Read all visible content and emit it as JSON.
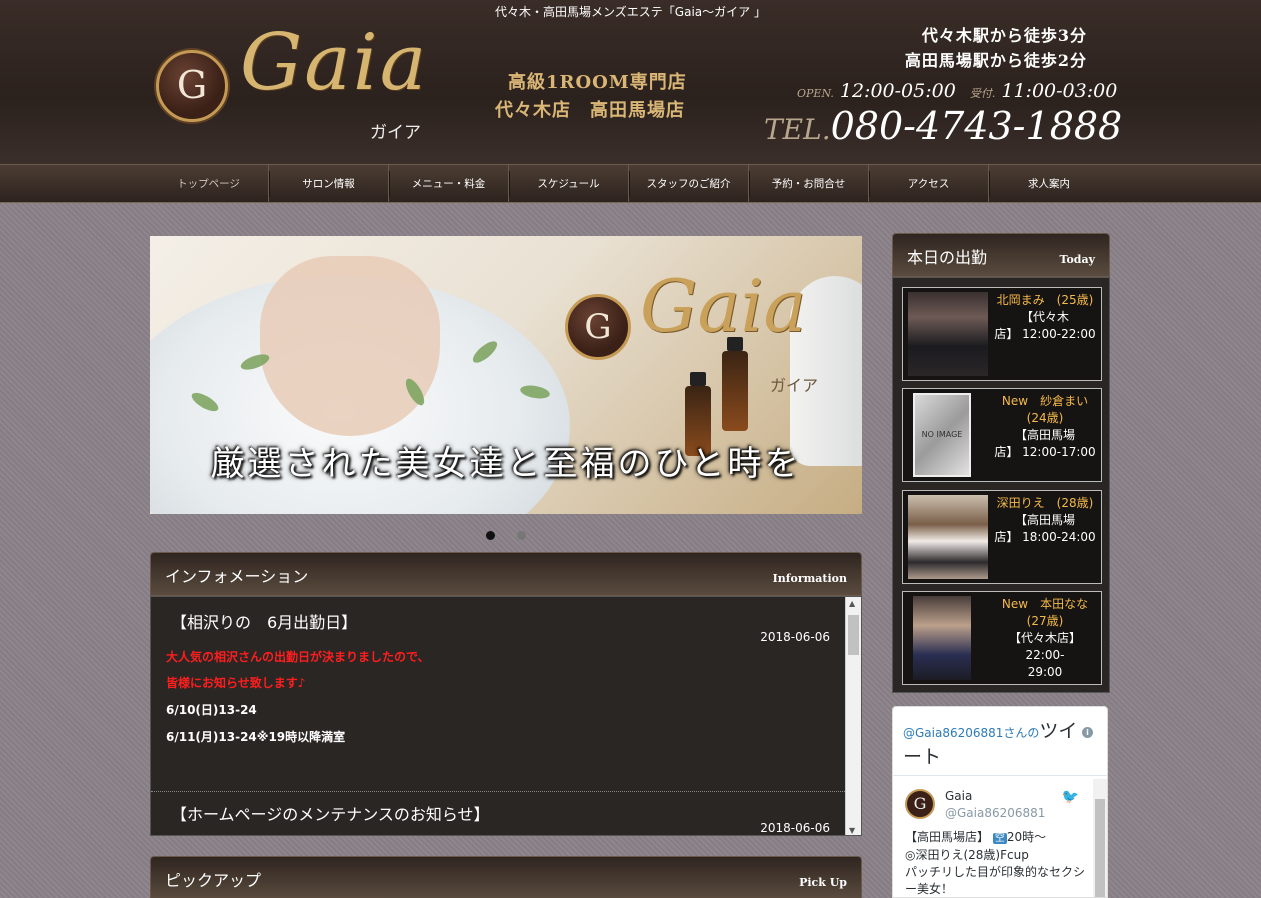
{
  "header": {
    "tagline": "代々木・高田馬場メンズエステ「Gaia～ガイア 」",
    "logo_letter": "G",
    "logo_script": "Gaia",
    "logo_kana": "ガイア",
    "shop_type": "高級1ROOM専門店",
    "shop_stores": "代々木店　高田馬場店",
    "access1": "代々木駅から徒歩3分",
    "access2": "高田馬場駅から徒歩2分",
    "open_label": "OPEN.",
    "open_hours": "12:00-05:00",
    "reception_label": "受付.",
    "reception_hours": "11:00-03:00",
    "tel_label": "TEL.",
    "tel": "080-4743-1888"
  },
  "nav": {
    "items": [
      {
        "label": "トップページ"
      },
      {
        "label": "サロン情報"
      },
      {
        "label": "メニュー・料金"
      },
      {
        "label": "スケジュール"
      },
      {
        "label": "スタッフのご紹介"
      },
      {
        "label": "予約・お問合せ"
      },
      {
        "label": "アクセス"
      },
      {
        "label": "求人案内"
      }
    ]
  },
  "hero": {
    "logo_letter": "G",
    "logo_script": "Gaia",
    "logo_kana": "ガイア",
    "caption": "厳選された美女達と至福のひと時を"
  },
  "info": {
    "title": "インフォメーション",
    "en": "Information",
    "posts": [
      {
        "title": "【相沢りの　6月出勤日】",
        "date": "2018-06-06",
        "lines": [
          "大人気の相沢さんの出勤日が決まりましたので、",
          "皆様にお知らせ致します♪",
          "6/10(日)13-24",
          "6/11(月)13-24※19時以降満室"
        ]
      },
      {
        "title": "【ホームページのメンテナンスのお知らせ】",
        "date": "2018-06-06"
      }
    ]
  },
  "pickup": {
    "title": "ピックアップ",
    "en": "Pick Up"
  },
  "today": {
    "title": "本日の出勤",
    "en": "Today",
    "staff": [
      {
        "name": "北岡まみ　(25歳)",
        "store": "【代々木",
        "hours": "店】 12:00-22:00"
      },
      {
        "name": "New　紗倉まい　(24歳)",
        "store": "【高田馬場",
        "hours": "店】 12:00-17:00",
        "photo": "NO IMAGE"
      },
      {
        "name": "深田りえ　(28歳)",
        "store": "【高田馬場",
        "hours": "店】 18:00-24:00"
      },
      {
        "name": "New　本田なな　(27歳)",
        "store": "【代々木店】 22:00-",
        "hours": "29:00"
      }
    ]
  },
  "twitter": {
    "account": "@Gaia86206881さんの",
    "label": "ツイート",
    "user_name": "Gaia",
    "user_handle": "@Gaia86206881",
    "tweet_1": "【高田馬場店】",
    "tweet_badge": "空",
    "tweet_2": "20時～",
    "tweet_3": "◎深田りえ(28歳)Fcup",
    "tweet_4": "パッチリした目が印象的なセクシー美女！"
  }
}
